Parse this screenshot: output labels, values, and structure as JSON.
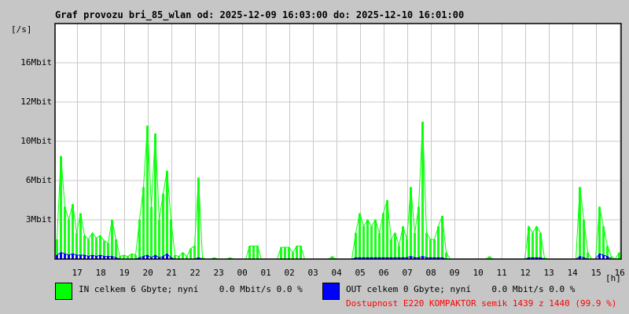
{
  "chart_data": {
    "type": "area",
    "title": "Graf provozu bri_85_wlan od: 2025-12-09 16:03:00 do: 2025-12-10 16:01:00",
    "ylabel": "[/s]",
    "xlabel": "[h]",
    "yticks": [
      {
        "label": "3Mbit",
        "value": 3
      },
      {
        "label": "6Mbit",
        "value": 6
      },
      {
        "label": "10Mbit",
        "value": 10
      },
      {
        "label": "12Mbit",
        "value": 12
      },
      {
        "label": "16Mbit",
        "value": 16
      }
    ],
    "xticks": [
      "17",
      "18",
      "19",
      "20",
      "21",
      "22",
      "23",
      "00",
      "01",
      "02",
      "03",
      "04",
      "05",
      "06",
      "07",
      "08",
      "09",
      "10",
      "11",
      "12",
      "13",
      "14",
      "15",
      "16"
    ],
    "x_interval_minutes": 10,
    "series": [
      {
        "name": "IN",
        "color": "#00ff00",
        "values": [
          1.5,
          8.5,
          4,
          3,
          4.2,
          2,
          3.5,
          1.8,
          1.5,
          2,
          1.6,
          1.8,
          1.4,
          1.2,
          3,
          1.5,
          0.2,
          0.3,
          0.2,
          0.4,
          0.3,
          3,
          5.5,
          10.8,
          4,
          10.4,
          3,
          5,
          7,
          3,
          0.3,
          0.2,
          0.5,
          0.2,
          0.8,
          1,
          6.3,
          0.1,
          0,
          0,
          0.1,
          0,
          0,
          0,
          0.1,
          0,
          0,
          0,
          0,
          1,
          1,
          1,
          0,
          0,
          0,
          0,
          0,
          0.9,
          0.9,
          0.9,
          0.5,
          1,
          1,
          0,
          0,
          0,
          0,
          0,
          0,
          0,
          0.2,
          0,
          0,
          0,
          0,
          0,
          2,
          3.5,
          2.5,
          3,
          2.5,
          3,
          2,
          3.5,
          4.5,
          1.5,
          2,
          1,
          2.5,
          1.5,
          5.5,
          2,
          4,
          11,
          2,
          1.5,
          1.5,
          2.5,
          3.3,
          0.5,
          0,
          0,
          0,
          0,
          0,
          0,
          0,
          0,
          0,
          0,
          0.2,
          0,
          0,
          0,
          0,
          0,
          0,
          0,
          0,
          0,
          2.5,
          2,
          2.5,
          2,
          0.1,
          0,
          0,
          0,
          0,
          0,
          0,
          0,
          0,
          5.5,
          3,
          0.5,
          0,
          0,
          4,
          2.5,
          1,
          0.2,
          0,
          0.5
        ]
      },
      {
        "name": "OUT",
        "color": "#0000ff",
        "values": [
          0.3,
          0.5,
          0.4,
          0.3,
          0.4,
          0.3,
          0.3,
          0.3,
          0.2,
          0.3,
          0.2,
          0.3,
          0.2,
          0.2,
          0.2,
          0.1,
          0,
          0,
          0,
          0,
          0,
          0.1,
          0.2,
          0.3,
          0.1,
          0.3,
          0.1,
          0.2,
          0.4,
          0.1,
          0,
          0,
          0,
          0,
          0,
          0,
          0.1,
          0,
          0,
          0,
          0,
          0,
          0,
          0,
          0,
          0,
          0,
          0,
          0,
          0,
          0,
          0,
          0,
          0,
          0,
          0,
          0,
          0,
          0,
          0,
          0,
          0,
          0,
          0,
          0,
          0,
          0,
          0,
          0,
          0,
          0,
          0,
          0,
          0,
          0,
          0,
          0.1,
          0.1,
          0.1,
          0.1,
          0.1,
          0.1,
          0.1,
          0.1,
          0.1,
          0.1,
          0.1,
          0.1,
          0.1,
          0.1,
          0.2,
          0.1,
          0.1,
          0.2,
          0.1,
          0.1,
          0.1,
          0.1,
          0.1,
          0,
          0,
          0,
          0,
          0,
          0,
          0,
          0,
          0,
          0,
          0,
          0,
          0,
          0,
          0,
          0,
          0,
          0,
          0,
          0,
          0,
          0.1,
          0.1,
          0.1,
          0.1,
          0,
          0,
          0,
          0,
          0,
          0,
          0,
          0,
          0,
          0.2,
          0.1,
          0,
          0,
          0,
          0.4,
          0.3,
          0.2,
          0,
          0,
          0
        ]
      }
    ]
  },
  "legend": {
    "in": "IN celkem 6 Gbyte; nyní    0.0 Mbit/s 0.0 %",
    "out": "OUT celkem 0 Gbyte; nyní    0.0 Mbit/s 0.0 %",
    "availability": "Dostupnost E220 KOMPAKTOR semik 1439 z 1440 (99.9 %)",
    "in_color": "#00ff00",
    "out_color": "#0000ff",
    "availability_color": "#ff0000"
  }
}
